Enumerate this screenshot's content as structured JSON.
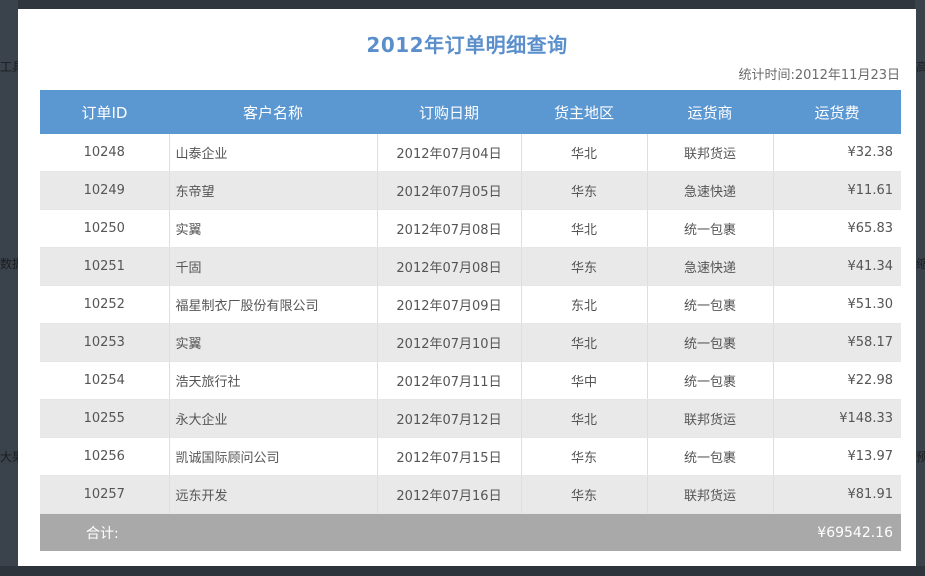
{
  "background_fragments": [
    "工具",
    "数据",
    "大果",
    "高",
    "缩",
    "预"
  ],
  "modal": {
    "title": "2012年订单明细查询",
    "stat_label": "统计时间:",
    "stat_value": "2012年11月23日"
  },
  "table": {
    "headers": [
      "订单ID",
      "客户名称",
      "订购日期",
      "货主地区",
      "运货商",
      "运货费"
    ],
    "rows": [
      {
        "id": "10248",
        "customer": "山泰企业",
        "date": "2012年07月04日",
        "region": "华北",
        "shipper": "联邦货运",
        "fee": "¥32.38"
      },
      {
        "id": "10249",
        "customer": "东帝望",
        "date": "2012年07月05日",
        "region": "华东",
        "shipper": "急速快递",
        "fee": "¥11.61"
      },
      {
        "id": "10250",
        "customer": "实翼",
        "date": "2012年07月08日",
        "region": "华北",
        "shipper": "统一包裹",
        "fee": "¥65.83"
      },
      {
        "id": "10251",
        "customer": "千固",
        "date": "2012年07月08日",
        "region": "华东",
        "shipper": "急速快递",
        "fee": "¥41.34"
      },
      {
        "id": "10252",
        "customer": "福星制衣厂股份有限公司",
        "date": "2012年07月09日",
        "region": "东北",
        "shipper": "统一包裹",
        "fee": "¥51.30"
      },
      {
        "id": "10253",
        "customer": "实翼",
        "date": "2012年07月10日",
        "region": "华北",
        "shipper": "统一包裹",
        "fee": "¥58.17"
      },
      {
        "id": "10254",
        "customer": "浩天旅行社",
        "date": "2012年07月11日",
        "region": "华中",
        "shipper": "统一包裹",
        "fee": "¥22.98"
      },
      {
        "id": "10255",
        "customer": "永大企业",
        "date": "2012年07月12日",
        "region": "华北",
        "shipper": "联邦货运",
        "fee": "¥148.33"
      },
      {
        "id": "10256",
        "customer": "凯诚国际顾问公司",
        "date": "2012年07月15日",
        "region": "华东",
        "shipper": "统一包裹",
        "fee": "¥13.97"
      },
      {
        "id": "10257",
        "customer": "远东开发",
        "date": "2012年07月16日",
        "region": "华东",
        "shipper": "联邦货运",
        "fee": "¥81.91"
      }
    ],
    "total_label": "合计:",
    "total_value": "¥69542.16"
  },
  "colors": {
    "title": "#5b8fcc",
    "header_bg": "#5b97d1",
    "row_alt_bg": "#e9e9e9",
    "total_bg": "#a9a9a9"
  }
}
